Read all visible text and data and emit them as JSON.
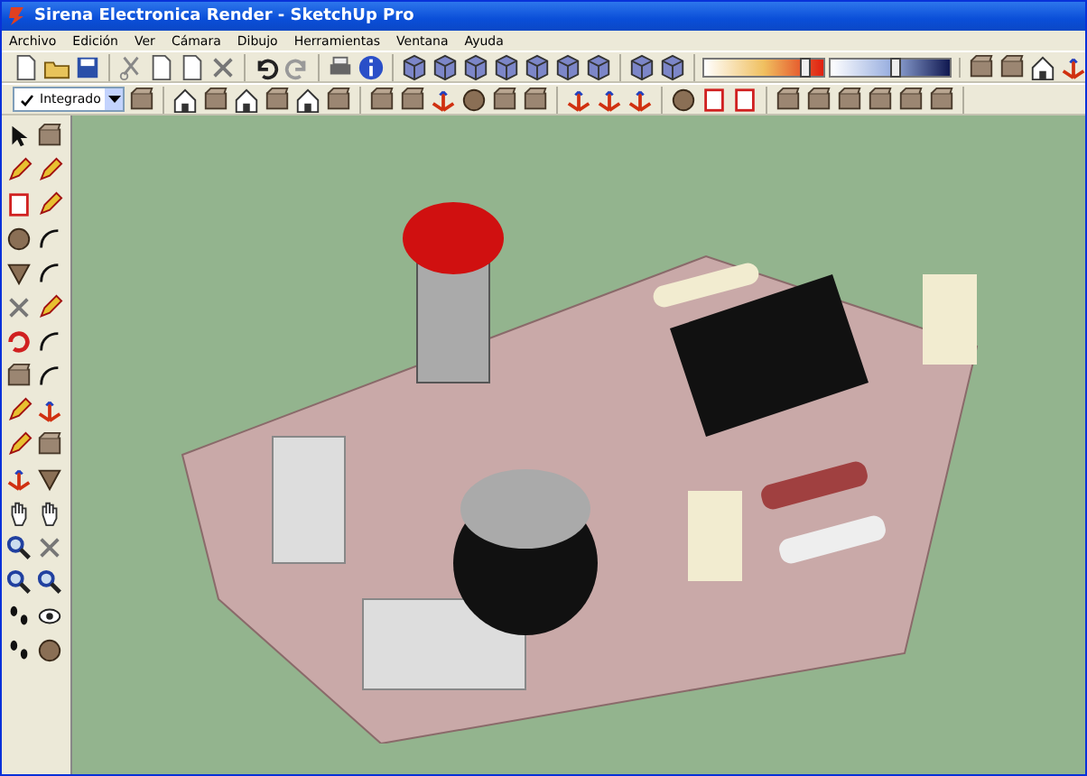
{
  "window": {
    "title": "Sirena Electronica Render - SketchUp Pro"
  },
  "menu_bar": [
    "Archivo",
    "Edición",
    "Ver",
    "Cámara",
    "Dibujo",
    "Herramientas",
    "Ventana",
    "Ayuda"
  ],
  "toolbar": {
    "style_dropdown": {
      "value": "Integrado"
    }
  },
  "shadow_settings": [
    {
      "kind": "time",
      "level": 0.85
    },
    {
      "kind": "date",
      "level": 0.55
    }
  ]
}
